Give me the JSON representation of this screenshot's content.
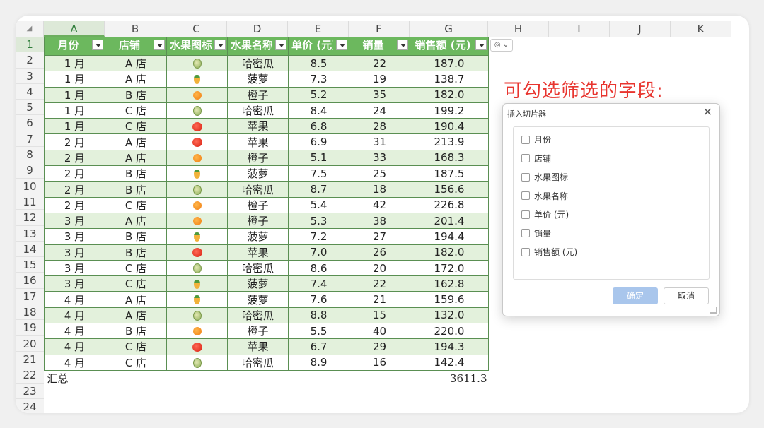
{
  "columns": [
    "A",
    "B",
    "C",
    "D",
    "E",
    "F",
    "G",
    "H",
    "I",
    "J",
    "K"
  ],
  "row_numbers": [
    "1",
    "2",
    "3",
    "4",
    "5",
    "6",
    "7",
    "8",
    "9",
    "10",
    "11",
    "12",
    "13",
    "14",
    "15",
    "16",
    "17",
    "18",
    "19",
    "20",
    "21",
    "22",
    "23",
    "24"
  ],
  "table": {
    "headers": [
      "月份",
      "店铺",
      "水果图标",
      "水果名称",
      "单价 (元)",
      "销量",
      "销售额 (元)"
    ],
    "rows": [
      {
        "month": "1 月",
        "store": "A 店",
        "icon": "melon-icon",
        "fruit": "哈密瓜",
        "price": "8.5",
        "qty": "22",
        "sales": "187.0"
      },
      {
        "month": "1 月",
        "store": "A 店",
        "icon": "pineapple-icon",
        "fruit": "菠萝",
        "price": "7.3",
        "qty": "19",
        "sales": "138.7"
      },
      {
        "month": "1 月",
        "store": "B 店",
        "icon": "orange-icon",
        "fruit": "橙子",
        "price": "5.2",
        "qty": "35",
        "sales": "182.0"
      },
      {
        "month": "1 月",
        "store": "C 店",
        "icon": "melon-icon",
        "fruit": "哈密瓜",
        "price": "8.4",
        "qty": "24",
        "sales": "199.2"
      },
      {
        "month": "1 月",
        "store": "C 店",
        "icon": "apple-icon",
        "fruit": "苹果",
        "price": "6.8",
        "qty": "28",
        "sales": "190.4"
      },
      {
        "month": "2 月",
        "store": "A 店",
        "icon": "apple-icon",
        "fruit": "苹果",
        "price": "6.9",
        "qty": "31",
        "sales": "213.9"
      },
      {
        "month": "2 月",
        "store": "A 店",
        "icon": "orange-icon",
        "fruit": "橙子",
        "price": "5.1",
        "qty": "33",
        "sales": "168.3"
      },
      {
        "month": "2 月",
        "store": "B 店",
        "icon": "pineapple-icon",
        "fruit": "菠萝",
        "price": "7.5",
        "qty": "25",
        "sales": "187.5"
      },
      {
        "month": "2 月",
        "store": "B 店",
        "icon": "melon-icon",
        "fruit": "哈密瓜",
        "price": "8.7",
        "qty": "18",
        "sales": "156.6"
      },
      {
        "month": "2 月",
        "store": "C 店",
        "icon": "orange-icon",
        "fruit": "橙子",
        "price": "5.4",
        "qty": "42",
        "sales": "226.8"
      },
      {
        "month": "3 月",
        "store": "A 店",
        "icon": "orange-icon",
        "fruit": "橙子",
        "price": "5.3",
        "qty": "38",
        "sales": "201.4"
      },
      {
        "month": "3 月",
        "store": "B 店",
        "icon": "pineapple-icon",
        "fruit": "菠萝",
        "price": "7.2",
        "qty": "27",
        "sales": "194.4"
      },
      {
        "month": "3 月",
        "store": "B 店",
        "icon": "apple-icon",
        "fruit": "苹果",
        "price": "7.0",
        "qty": "26",
        "sales": "182.0"
      },
      {
        "month": "3 月",
        "store": "C 店",
        "icon": "melon-icon",
        "fruit": "哈密瓜",
        "price": "8.6",
        "qty": "20",
        "sales": "172.0"
      },
      {
        "month": "3 月",
        "store": "C 店",
        "icon": "pineapple-icon",
        "fruit": "菠萝",
        "price": "7.4",
        "qty": "22",
        "sales": "162.8"
      },
      {
        "month": "4 月",
        "store": "A 店",
        "icon": "pineapple-icon",
        "fruit": "菠萝",
        "price": "7.6",
        "qty": "21",
        "sales": "159.6"
      },
      {
        "month": "4 月",
        "store": "A 店",
        "icon": "melon-icon",
        "fruit": "哈密瓜",
        "price": "8.8",
        "qty": "15",
        "sales": "132.0"
      },
      {
        "month": "4 月",
        "store": "B 店",
        "icon": "orange-icon",
        "fruit": "橙子",
        "price": "5.5",
        "qty": "40",
        "sales": "220.0"
      },
      {
        "month": "4 月",
        "store": "C 店",
        "icon": "apple-icon",
        "fruit": "苹果",
        "price": "6.7",
        "qty": "29",
        "sales": "194.3"
      },
      {
        "month": "4 月",
        "store": "C 店",
        "icon": "melon-icon",
        "fruit": "哈密瓜",
        "price": "8.9",
        "qty": "16",
        "sales": "142.4"
      }
    ],
    "total_label": "汇总",
    "total_value": "3611.3"
  },
  "annotation": "可勾选筛选的字段:",
  "dialog": {
    "title": "插入切片器",
    "close": "✕",
    "options": [
      "月份",
      "店铺",
      "水果图标",
      "水果名称",
      "单价 (元)",
      "销量",
      "销售额 (元)"
    ],
    "ok_label": "确定",
    "cancel_label": "取消"
  },
  "colors": {
    "header_green": "#6cb85e",
    "band_green": "#e3f1dc",
    "annotation_red": "#e8352f"
  }
}
